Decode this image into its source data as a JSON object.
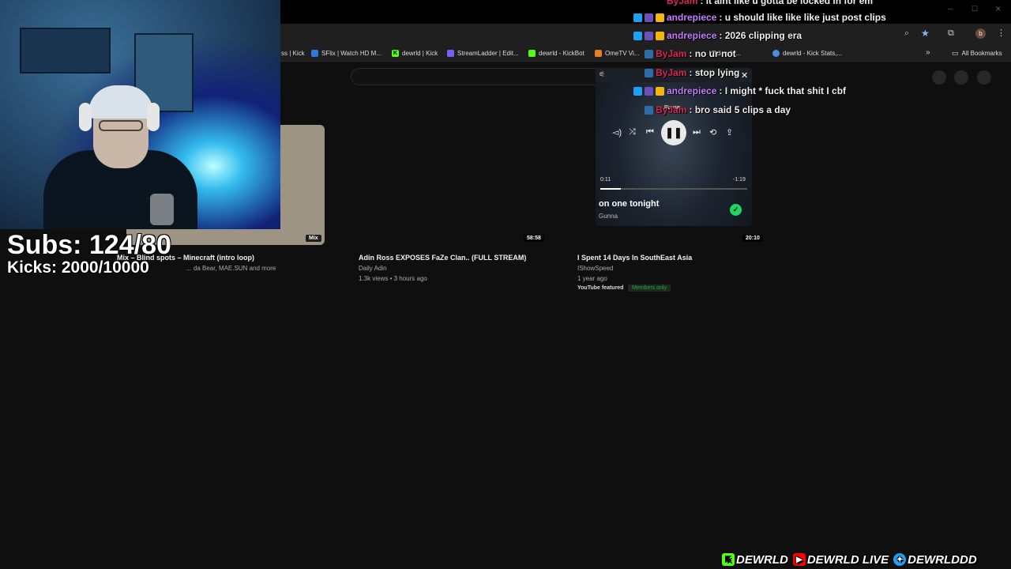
{
  "browser": {
    "bookmarks": [
      {
        "label": "ss | Kick",
        "color": "#53fc18"
      },
      {
        "label": "SFlix | Watch HD M...",
        "color": "#2b7bd9"
      },
      {
        "label": "dewrld | Kick",
        "color": "#53fc18"
      },
      {
        "label": "StreamLadder | Edit...",
        "color": "#7a5cff"
      },
      {
        "label": "dewrld - KickBot",
        "color": "#53fc18"
      },
      {
        "label": "OmeTV Vi...",
        "color": "#e67e22"
      },
      {
        "label": "... (@dewrld...",
        "color": "#888888"
      },
      {
        "label": "dewrld - Kick Stats,...",
        "color": "#4a90d9"
      }
    ],
    "all_bookmarks_label": "All Bookmarks",
    "profile_initial": "b"
  },
  "videos": [
    {
      "title": "Mix – Blind spots – Minecraft (intro loop)",
      "meta1": "... da Bear, MAE.SUN and more",
      "duration": "Mix"
    },
    {
      "title": "Adin Ross EXPOSES FaZe Clan.. (FULL STREAM)",
      "meta1": "Daily Adin",
      "meta2": "1.3k views • 3 hours ago",
      "duration": "58:58"
    },
    {
      "title": "I Spent 14 Days In SouthEast Asia",
      "meta1": "IShowSpeed",
      "meta2": "1 year ago",
      "tag1": "YouTube featured",
      "tag2": "Members only",
      "duration": "20:10"
    }
  ],
  "overlay": {
    "subs": "Subs: 124/80",
    "kicks": "Kicks: 2000/10000"
  },
  "chat": [
    {
      "user": "ByJam",
      "message": ": it aint like u gotta be locked in for em",
      "color": "#e0245e"
    },
    {
      "user": "andrepiece",
      "message": ": u should like like like just post clips",
      "color": "#c77dff"
    },
    {
      "user": "andrepiece",
      "message": ": 2026 clipping era",
      "color": "#c77dff"
    },
    {
      "user": "ByJam",
      "message": ": no ur not",
      "color": "#e0245e"
    },
    {
      "user": "ByJam",
      "message": ": stop lying",
      "color": "#e0245e"
    },
    {
      "user": "andrepiece",
      "message": ": I might * fuck that shit I cbf",
      "color": "#c77dff"
    },
    {
      "user": "ByJam",
      "message": ": bro said 5 clips a day",
      "color": "#e0245e"
    }
  ],
  "player": {
    "tooltip": "Pause",
    "time_elapsed": "0:11",
    "time_remaining": "-1:19",
    "progress": 0.14,
    "song": "on one tonight",
    "artist": "Gunna"
  },
  "socials": {
    "kick": "DEWRLD",
    "youtube": "DEWRLD LIVE",
    "twitter": "DEWRLDDD"
  },
  "colors": {
    "kick_green": "#53fc18",
    "youtube_red": "#ff0000",
    "twitter_blue": "#1da1f2",
    "liked_green": "#1ed760"
  }
}
